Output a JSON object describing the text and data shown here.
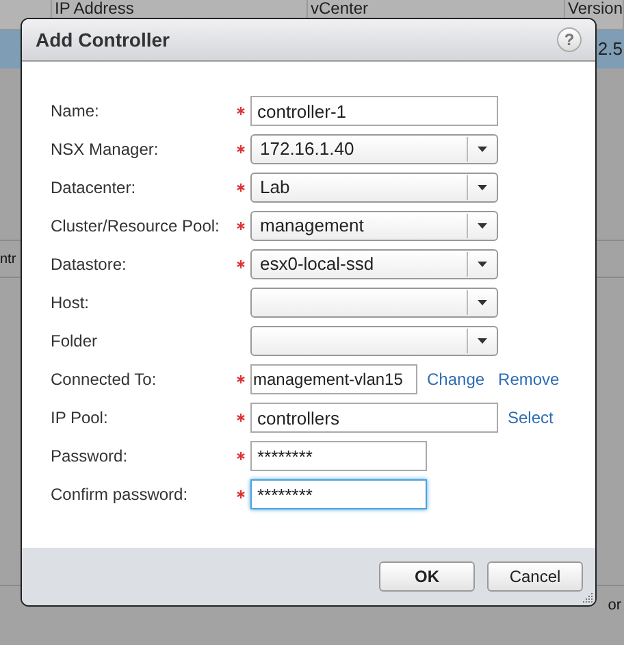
{
  "background_table": {
    "columns": [
      "IP Address",
      "vCenter",
      "Version"
    ],
    "fragments": [
      "2.5",
      "ntr",
      "or"
    ]
  },
  "dialog": {
    "title": "Add Controller",
    "help": "?",
    "fields": [
      {
        "kind": "text",
        "label": "Name:",
        "required": true,
        "value": "controller-1",
        "focused": false
      },
      {
        "kind": "select",
        "label": "NSX Manager:",
        "required": true,
        "value": "172.16.1.40"
      },
      {
        "kind": "select",
        "label": "Datacenter:",
        "required": true,
        "value": "Lab"
      },
      {
        "kind": "select",
        "label": "Cluster/Resource Pool:",
        "required": true,
        "value": "management"
      },
      {
        "kind": "select",
        "label": "Datastore:",
        "required": true,
        "value": "esx0-local-ssd"
      },
      {
        "kind": "select",
        "label": "Host:",
        "required": false
      },
      {
        "kind": "select",
        "label": "Folder",
        "required": false
      },
      {
        "kind": "picker",
        "label": "Connected To:",
        "required": true,
        "value": "management-vlan15",
        "links": [
          "Change",
          "Remove"
        ]
      },
      {
        "kind": "picker_wide",
        "label": "IP Pool:",
        "required": true,
        "value": "controllers",
        "links": [
          "Select"
        ]
      },
      {
        "kind": "password",
        "label": "Password:",
        "required": true,
        "value": "********",
        "focused": false
      },
      {
        "kind": "password",
        "label": "Confirm password:",
        "required": true,
        "value": "********",
        "focused": true
      }
    ],
    "buttons": [
      "OK",
      "Cancel"
    ]
  }
}
